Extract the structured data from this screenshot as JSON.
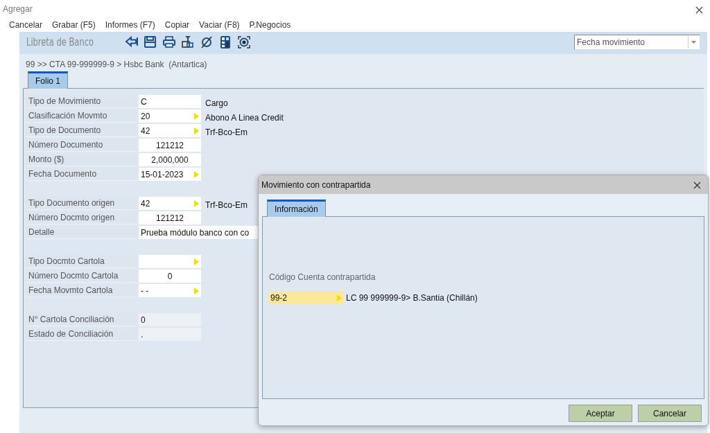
{
  "window": {
    "title": "Agregar"
  },
  "menu": [
    "Cancelar",
    "Grabar (F5)",
    "Informes (F7)",
    "Copiar",
    "Vaciar (F8)",
    "P.Negocios"
  ],
  "toolbar": {
    "title": "Libreta de Banco",
    "sort_select": {
      "value": "Fecha movimiento"
    }
  },
  "breadcrumb": "99 >> CTA 99-999999-9 > Hsbc Bank  (Antartica)",
  "tabs": [
    {
      "label": "Folio 1",
      "selected": true
    }
  ],
  "sections": [
    [
      {
        "label": "Tipo de Movimiento",
        "value": "C",
        "kind": "text",
        "description": "Cargo"
      },
      {
        "label": "Clasificación Movmto",
        "value": "20",
        "kind": "lookup",
        "description": "Abono A Linea Credit"
      },
      {
        "label": "Tipo de Documento",
        "value": "42",
        "kind": "lookup",
        "description": "Trf-Bco-Em"
      },
      {
        "label": "Número Documento",
        "value": "121212",
        "kind": "number"
      },
      {
        "label": "Monto ($)",
        "value": "2,000,000",
        "kind": "number"
      },
      {
        "label": "Fecha Documento",
        "value": "15-01-2023",
        "kind": "lookup"
      }
    ],
    [
      {
        "label": "Tipo Documento origen",
        "value": "42",
        "kind": "lookup",
        "description": "Trf-Bco-Em"
      },
      {
        "label": "Número Docmto origen",
        "value": "121212",
        "kind": "number"
      },
      {
        "label": "Detalle",
        "value": "Prueba módulo banco con co",
        "kind": "wide"
      }
    ],
    [
      {
        "label": "Tipo Docmto Cartola",
        "kind": "lookup"
      },
      {
        "label": "Número Docmto Cartola",
        "value": "0",
        "kind": "number"
      },
      {
        "label": "Fecha Movmto Cartola",
        "value": "- -",
        "kind": "lookup"
      }
    ],
    [
      {
        "label": "N° Cartola Conciliación",
        "value": "0",
        "kind": "readonly"
      },
      {
        "label": "Estado de Conciliación",
        "value": ".",
        "kind": "readonly"
      }
    ]
  ],
  "dialog": {
    "title": "Movimiento con contrapartida",
    "tabs": [
      {
        "label": "Información",
        "selected": true
      }
    ],
    "field_label": "Código Cuenta contrapartida",
    "field_value": "99-2",
    "field_description": "LC 99 999999-9> B.Santia (Chillán)",
    "buttons": [
      "Aceptar",
      "Cancelar"
    ]
  }
}
